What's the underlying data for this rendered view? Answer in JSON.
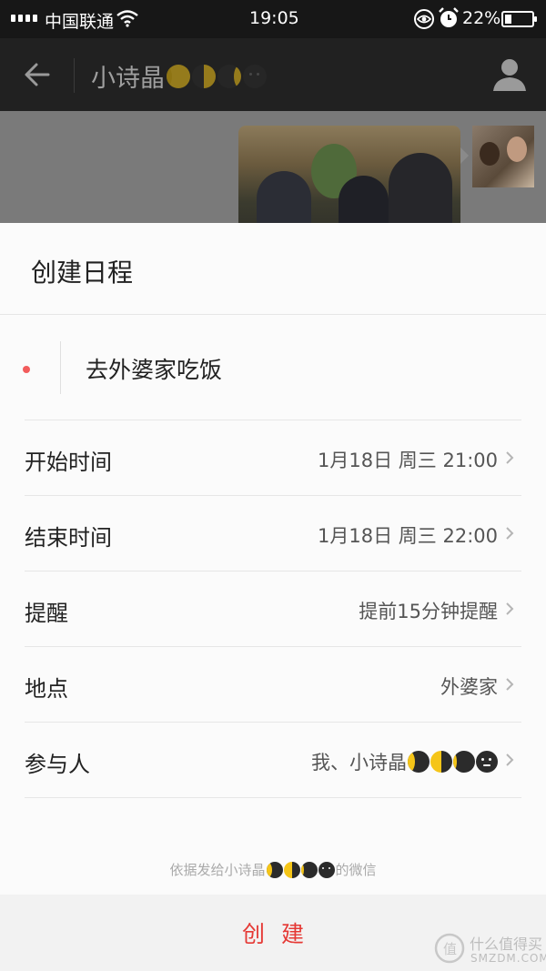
{
  "status_bar": {
    "carrier": "中国联通",
    "time": "19:05",
    "battery_percent": "22%"
  },
  "nav": {
    "title": "小诗晶",
    "title_moons": [
      "waxing-gibbous",
      "first-quarter",
      "waxing-crescent",
      "new-moon-face"
    ]
  },
  "sheet": {
    "title": "创建日程",
    "event_title": "去外婆家吃饭",
    "rows": [
      {
        "label": "开始时间",
        "value": "1月18日 周三 21:00"
      },
      {
        "label": "结束时间",
        "value": "1月18日 周三 22:00"
      },
      {
        "label": "提醒",
        "value": "提前15分钟提醒"
      },
      {
        "label": "地点",
        "value": "外婆家"
      },
      {
        "label": "参与人",
        "value": "我、小诗晶"
      }
    ],
    "footer_prefix": "依据发给小诗晶",
    "footer_suffix": "的微信",
    "create_label": "创建"
  },
  "watermark": {
    "line1": "什么值得买",
    "line2": "SMZDM.COM"
  },
  "colors": {
    "accent": "#e53935",
    "event_dot": "#f25c5c",
    "moon_yellow": "#f5c518",
    "moon_dark": "#2b2b2b"
  }
}
